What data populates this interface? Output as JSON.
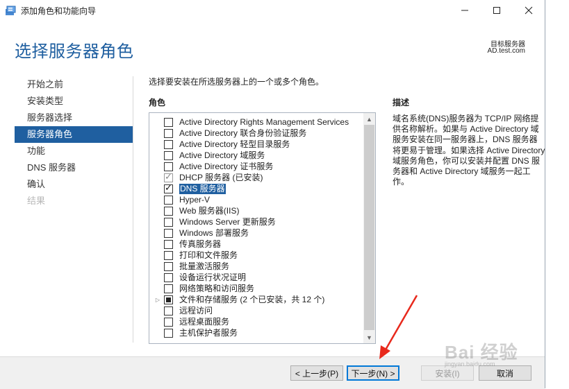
{
  "window": {
    "title": "添加角色和功能向导",
    "minimize_label": "minimize",
    "maximize_label": "maximize",
    "close_label": "close"
  },
  "header": {
    "page_title": "选择服务器角色",
    "target_label": "目标服务器",
    "target_server": "AD.test.com"
  },
  "nav": {
    "items": [
      {
        "label": "开始之前",
        "state": "normal"
      },
      {
        "label": "安装类型",
        "state": "normal"
      },
      {
        "label": "服务器选择",
        "state": "normal"
      },
      {
        "label": "服务器角色",
        "state": "active"
      },
      {
        "label": "功能",
        "state": "normal"
      },
      {
        "label": "DNS 服务器",
        "state": "normal"
      },
      {
        "label": "确认",
        "state": "normal"
      },
      {
        "label": "结果",
        "state": "disabled"
      }
    ]
  },
  "content": {
    "instruction": "选择要安装在所选服务器上的一个或多个角色。",
    "roles_heading": "角色",
    "description_heading": "描述",
    "description": "域名系统(DNS)服务器为 TCP/IP 网络提供名称解析。如果与 Active Directory 域服务安装在同一服务器上，DNS 服务器将更易于管理。如果选择 Active Directory 域服务角色，你可以安装并配置 DNS 服务器和 Active Directory 域服务一起工作。"
  },
  "roles": [
    {
      "label": "Active Directory Rights Management Services",
      "state": "unchecked"
    },
    {
      "label": "Active Directory 联合身份验证服务",
      "state": "unchecked"
    },
    {
      "label": "Active Directory 轻型目录服务",
      "state": "unchecked"
    },
    {
      "label": "Active Directory 域服务",
      "state": "unchecked"
    },
    {
      "label": "Active Directory 证书服务",
      "state": "unchecked"
    },
    {
      "label": "DHCP 服务器 (已安装)",
      "state": "installed"
    },
    {
      "label": "DNS 服务器",
      "state": "checked",
      "selected": true
    },
    {
      "label": "Hyper-V",
      "state": "unchecked"
    },
    {
      "label": "Web 服务器(IIS)",
      "state": "unchecked"
    },
    {
      "label": "Windows Server 更新服务",
      "state": "unchecked"
    },
    {
      "label": "Windows 部署服务",
      "state": "unchecked"
    },
    {
      "label": "传真服务器",
      "state": "unchecked"
    },
    {
      "label": "打印和文件服务",
      "state": "unchecked"
    },
    {
      "label": "批量激活服务",
      "state": "unchecked"
    },
    {
      "label": "设备运行状况证明",
      "state": "unchecked"
    },
    {
      "label": "网络策略和访问服务",
      "state": "unchecked"
    },
    {
      "label": "文件和存储服务 (2 个已安装，共 12 个)",
      "state": "partial",
      "expandable": true
    },
    {
      "label": "远程访问",
      "state": "unchecked"
    },
    {
      "label": "远程桌面服务",
      "state": "unchecked"
    },
    {
      "label": "主机保护者服务",
      "state": "unchecked"
    }
  ],
  "footer": {
    "prev_label": "< 上一步(P)",
    "next_label": "下一步(N) >",
    "install_label": "安装(I)",
    "cancel_label": "取消"
  },
  "overlay": {
    "watermark": "Bai 经验",
    "watermark_sub": "jingyan.baidu.com",
    "arrow_color": "#e8291c"
  },
  "colors": {
    "accent": "#1f5fa0",
    "selection": "#1f5fa0"
  }
}
